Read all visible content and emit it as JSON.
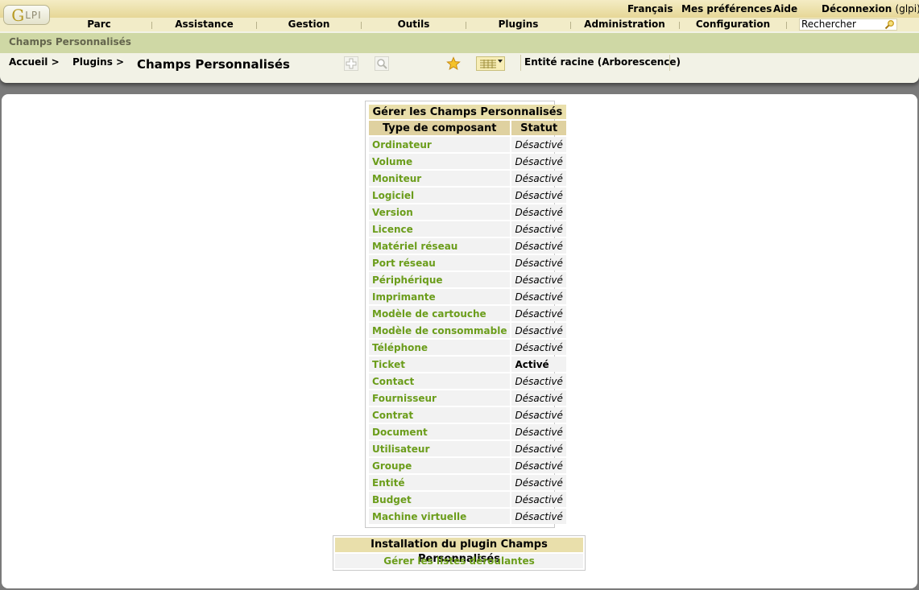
{
  "toplinks": {
    "language": "Français",
    "preferences": "Mes préférences",
    "help": "Aide",
    "logout": "Déconnexion",
    "user": "(glpi)"
  },
  "logo": {
    "g": "G",
    "lpi": "LPI"
  },
  "menu": [
    "Parc",
    "Assistance",
    "Gestion",
    "Outils",
    "Plugins",
    "Administration",
    "Configuration"
  ],
  "search": {
    "value": "Rechercher"
  },
  "section_title": "Champs Personnalisés",
  "breadcrumb": {
    "home": "Accueil >",
    "plugins": "Plugins >"
  },
  "page_title": "Champs Personnalisés",
  "toolbar": {
    "add_icon": "plus-icon",
    "search_icon": "magnifier-icon",
    "bookmark_icon": "star-icon",
    "display_pref_icon": "column-list-icon"
  },
  "entity": "Entité racine (Arborescence)",
  "manage_table": {
    "title": "Gérer les Champs Personnalisés",
    "col_component": "Type de composant",
    "col_status": "Statut",
    "rows": [
      {
        "name": "Ordinateur",
        "status": "Désactivé"
      },
      {
        "name": "Volume",
        "status": "Désactivé"
      },
      {
        "name": "Moniteur",
        "status": "Désactivé"
      },
      {
        "name": "Logiciel",
        "status": "Désactivé"
      },
      {
        "name": "Version",
        "status": "Désactivé"
      },
      {
        "name": "Licence",
        "status": "Désactivé"
      },
      {
        "name": "Matériel réseau",
        "status": "Désactivé"
      },
      {
        "name": "Port réseau",
        "status": "Désactivé"
      },
      {
        "name": "Périphérique",
        "status": "Désactivé"
      },
      {
        "name": "Imprimante",
        "status": "Désactivé"
      },
      {
        "name": "Modèle de cartouche",
        "status": "Désactivé"
      },
      {
        "name": "Modèle de consommable",
        "status": "Désactivé"
      },
      {
        "name": "Téléphone",
        "status": "Désactivé"
      },
      {
        "name": "Ticket",
        "status": "Activé"
      },
      {
        "name": "Contact",
        "status": "Désactivé"
      },
      {
        "name": "Fournisseur",
        "status": "Désactivé"
      },
      {
        "name": "Contrat",
        "status": "Désactivé"
      },
      {
        "name": "Document",
        "status": "Désactivé"
      },
      {
        "name": "Utilisateur",
        "status": "Désactivé"
      },
      {
        "name": "Groupe",
        "status": "Désactivé"
      },
      {
        "name": "Entité",
        "status": "Désactivé"
      },
      {
        "name": "Budget",
        "status": "Désactivé"
      },
      {
        "name": "Machine virtuelle",
        "status": "Désactivé"
      }
    ]
  },
  "install_box": {
    "title": "Installation du plugin Champs Personnalisés",
    "link": "Gérer les listes déroulantes"
  },
  "colors": {
    "link_green": "#6b9d1b",
    "header_tan": "#e9dfab",
    "section_green": "#cfd8a5"
  }
}
